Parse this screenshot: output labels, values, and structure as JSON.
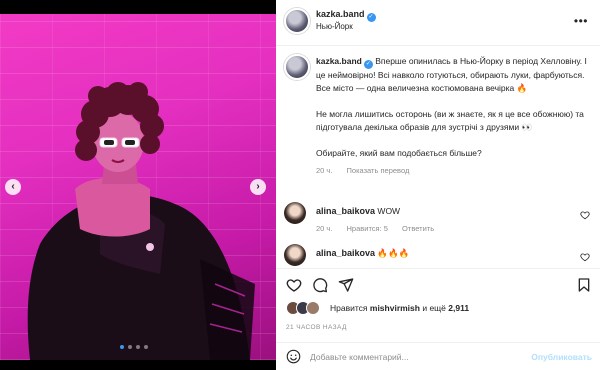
{
  "post": {
    "account": "kazka.band",
    "location": "Нью-Йорк",
    "caption": {
      "p1": "Вперше опинилась в Нью-Йорку в період Хелловіну. І це неймовірно! Всі навколо готуються, обирають луки, фарбуються. Все місто — одна величезна костюмована вечірка",
      "p1_emoji": "🔥",
      "p2": "Не могла лишитись осторонь (ви ж знаєте, як я це все обожнюю) та підготувала декілька образів для зустрічі з друзями",
      "p2_emoji": "👀",
      "p3": "Обирайте, який вам подобається більше?",
      "time": "20 ч.",
      "translate": "Показать перевод"
    },
    "comments": [
      {
        "user": "alina_baikova",
        "text": "WOW",
        "time": "20 ч.",
        "likes": "Нравится: 5",
        "reply": "Ответить"
      },
      {
        "user": "alina_baikova",
        "text": "🔥🔥🔥",
        "time": "",
        "likes": "",
        "reply": ""
      }
    ],
    "likes": {
      "prefix": "Нравится",
      "user": "mishvirmish",
      "and": "и ещё",
      "count": "2,911"
    },
    "time_ago": "21 ЧАСОВ НАЗАД",
    "add_comment": {
      "placeholder": "Добавьте комментарий...",
      "publish": "Опубликовать"
    },
    "carousel": {
      "slides": 4,
      "active_index": 0
    },
    "colors": {
      "accent": "#3897f0",
      "photo_magenta": "#e42fc0",
      "publish_disabled": "#b2dffc"
    },
    "icons": {
      "more": "more-horizontal-icon",
      "heart": "heart-icon",
      "comment": "comment-icon",
      "share": "paper-plane-icon",
      "save": "bookmark-icon",
      "emoji": "smiley-icon",
      "nav_prev": "chevron-left-icon",
      "nav_next": "chevron-right-icon"
    }
  }
}
